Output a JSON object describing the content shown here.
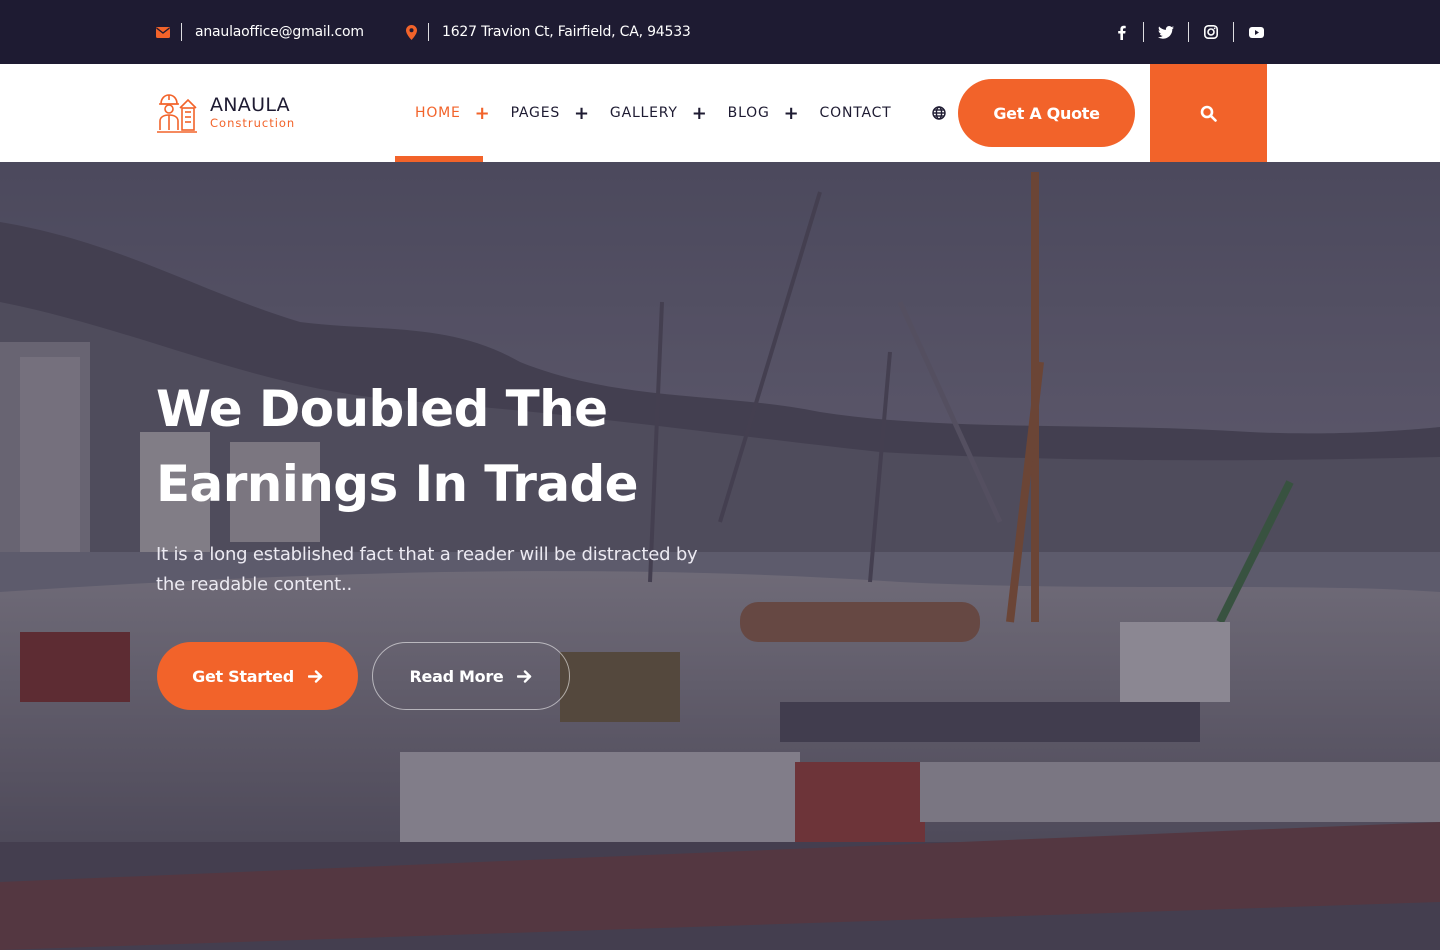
{
  "topbar": {
    "email": "anaulaoffice@gmail.com",
    "address": "1627 Travion Ct, Fairfield, CA, 94533",
    "socials": [
      {
        "name": "facebook-icon"
      },
      {
        "name": "twitter-icon"
      },
      {
        "name": "instagram-icon"
      },
      {
        "name": "youtube-icon"
      }
    ]
  },
  "header": {
    "logo_name": "ANAULA",
    "logo_sub": "Construction",
    "nav": [
      {
        "label": "HOME",
        "has_submenu": true,
        "active": true
      },
      {
        "label": "PAGES",
        "has_submenu": true
      },
      {
        "label": "GALLERY",
        "has_submenu": true
      },
      {
        "label": "BLOG",
        "has_submenu": true
      },
      {
        "label": "CONTACT",
        "has_submenu": false
      }
    ],
    "quote_button": "Get A Quote"
  },
  "hero": {
    "title_line1": "We Doubled The",
    "title_line2": "Earnings In Trade",
    "text": "It is a long established fact that a reader will be distracted by the readable content..",
    "primary_button": "Get Started",
    "secondary_button": "Read More"
  },
  "colors": {
    "accent": "#f2632a",
    "dark": "#1e1b32",
    "white": "#ffffff"
  }
}
